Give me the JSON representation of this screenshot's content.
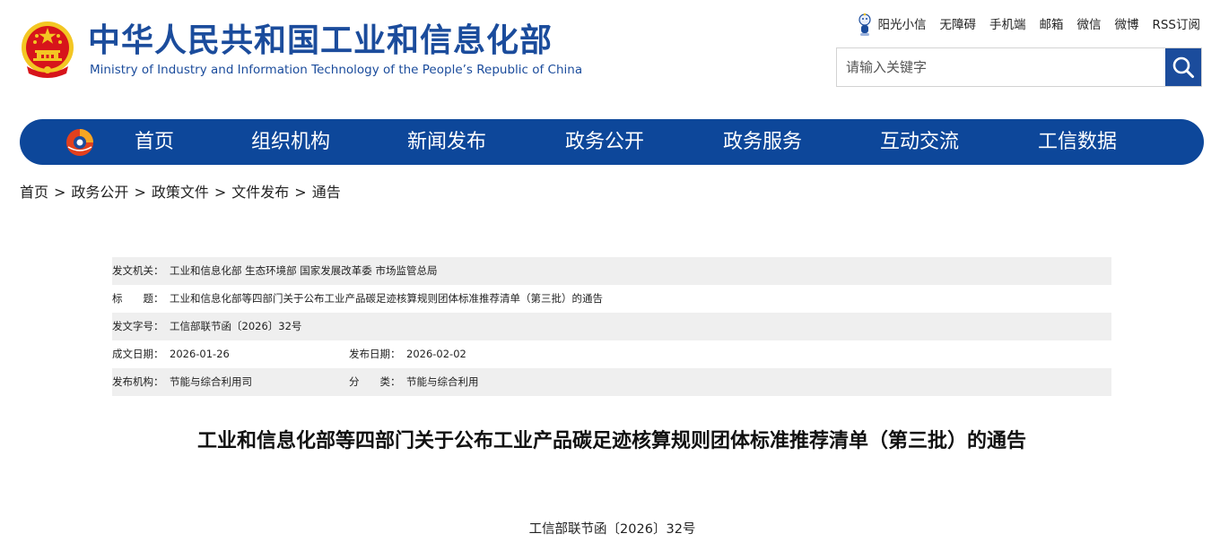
{
  "header": {
    "title_cn": "中华人民共和国工业和信息化部",
    "title_en": "Ministry of Industry and Information Technology of the People’s Republic of China",
    "top_links": {
      "sunshine": "阳光小信",
      "accessibility": "无障碍",
      "mobile": "手机端",
      "mail": "邮箱",
      "wechat": "微信",
      "weibo": "微博",
      "rss": "RSS订阅"
    },
    "search": {
      "placeholder": "请输入关键字"
    }
  },
  "nav": {
    "items": [
      "首页",
      "组织机构",
      "新闻发布",
      "政务公开",
      "政务服务",
      "互动交流",
      "工信数据"
    ]
  },
  "breadcrumb": {
    "items": [
      "首页",
      "政务公开",
      "政策文件",
      "文件发布",
      "通告"
    ],
    "separator": ">"
  },
  "meta": {
    "issuer_label": "发文机关：",
    "issuer_value": "工业和信息化部 生态环境部 国家发展改革委 市场监管总局",
    "title_label": "标　　题：",
    "title_value": "工业和信息化部等四部门关于公布工业产品碳足迹核算规则团体标准推荐清单（第三批）的通告",
    "docno_label": "发文字号：",
    "docno_value": "工信部联节函〔2026〕32号",
    "written_label": "成文日期：",
    "written_value": "2026-01-26",
    "published_label": "发布日期：",
    "published_value": "2026-02-02",
    "org_label": "发布机构：",
    "org_value": "节能与综合利用司",
    "category_label": "分　　类：",
    "category_value": "节能与综合利用"
  },
  "article": {
    "title": "工业和信息化部等四部门关于公布工业产品碳足迹核算规则团体标准推荐清单（第三批）的通告",
    "doc_number": "工信部联节函〔2026〕32号"
  },
  "colors": {
    "brand_blue": "#1b4c9c",
    "nav_blue": "#0d479a",
    "emblem_red": "#d7141b",
    "emblem_gold": "#f3c623",
    "meta_shade": "#efefef"
  },
  "icons": {
    "emblem": "national-emblem-icon",
    "sunshine": "sunshine-mascot-icon",
    "search": "search-icon",
    "nav_logo": "miit-logo-icon"
  }
}
